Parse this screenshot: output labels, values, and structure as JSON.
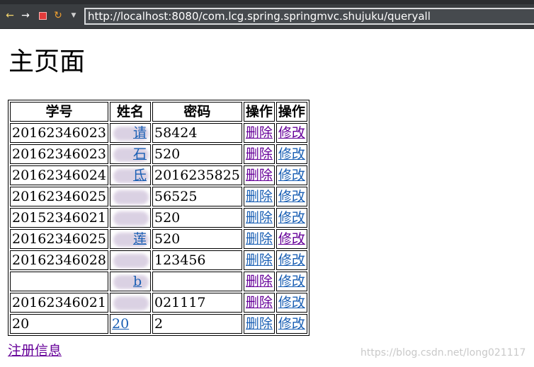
{
  "browser": {
    "url": "http://localhost:8080/com.lcg.spring.springmvc.shujuku/queryall"
  },
  "page": {
    "title": "主页面",
    "register_label": "注册信息"
  },
  "table": {
    "headers": [
      "学号",
      "姓名",
      "密码",
      "操作",
      "操作"
    ],
    "rows": [
      {
        "id": "20162346023",
        "name": "",
        "name_visible": "请",
        "password": "58424",
        "delete": "删除",
        "edit": "修改"
      },
      {
        "id": "20162346023",
        "name": "",
        "name_visible": "石",
        "password": "520",
        "delete": "删除",
        "edit": "修改"
      },
      {
        "id": "20162346024",
        "name": "",
        "name_visible": "氐",
        "password": "2016235825",
        "delete": "删除",
        "edit": "修改"
      },
      {
        "id": "20162346025",
        "name": "",
        "name_visible": "",
        "password": "56525",
        "delete": "删除",
        "edit": "修改"
      },
      {
        "id": "20152346021",
        "name": "",
        "name_visible": "",
        "password": "520",
        "delete": "删除",
        "edit": "修改"
      },
      {
        "id": "20162346025",
        "name": "",
        "name_visible": "莲",
        "password": "520",
        "delete": "删除",
        "edit": "修改"
      },
      {
        "id": "20162346028",
        "name": "",
        "name_visible": "",
        "password": "123456",
        "delete": "删除",
        "edit": "修改"
      },
      {
        "id": "",
        "name": "",
        "name_visible": "b",
        "password": "",
        "delete": "删除",
        "edit": "修改"
      },
      {
        "id": "20162346021",
        "name": "",
        "name_visible": "",
        "password": "021117",
        "delete": "删除",
        "edit": "修改"
      },
      {
        "id": "20",
        "name": "20",
        "name_visible": "20",
        "password": "2",
        "delete": "删除",
        "edit": "修改"
      }
    ]
  },
  "watermark": "https://blog.csdn.net/long021117"
}
